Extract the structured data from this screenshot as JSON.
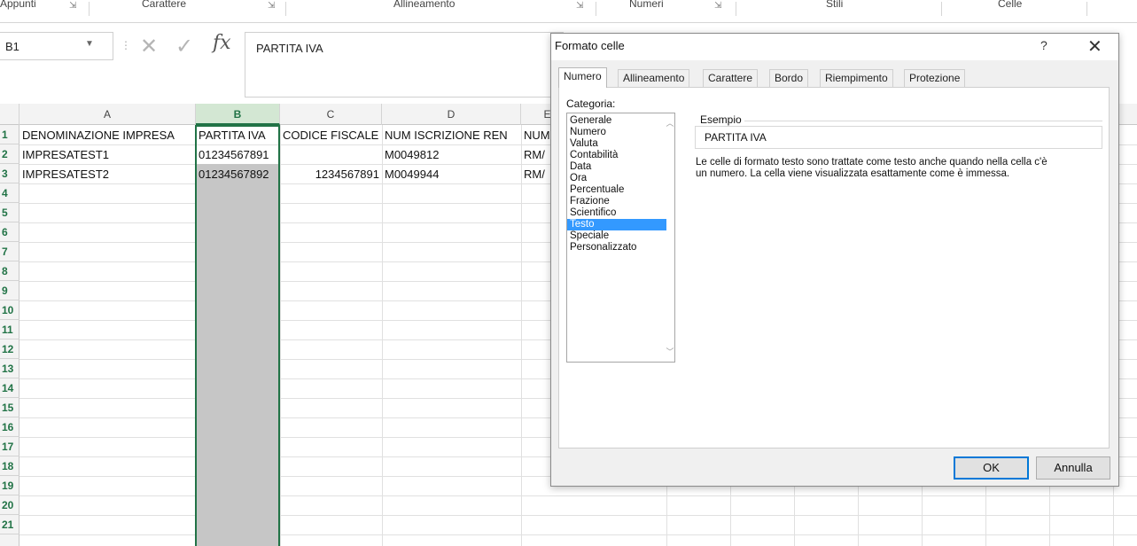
{
  "ribbon": {
    "groups": [
      {
        "label": "Appunti"
      },
      {
        "label": "Carattere"
      },
      {
        "label": "Allineamento"
      },
      {
        "label": "Numeri"
      },
      {
        "label": "Stili"
      },
      {
        "label": "Celle"
      }
    ]
  },
  "formula_bar": {
    "name_box": "B1",
    "fx": "fx",
    "value": "PARTITA IVA"
  },
  "sheet": {
    "columns": [
      "A",
      "B",
      "C",
      "D",
      "E"
    ],
    "selected_column": "B",
    "row_numbers": [
      "1",
      "2",
      "3",
      "4",
      "5",
      "6",
      "7",
      "8",
      "9",
      "10",
      "11",
      "12",
      "13",
      "14",
      "15",
      "16",
      "17",
      "18",
      "19",
      "20",
      "21"
    ],
    "rows": [
      [
        "DENOMINAZIONE IMPRESA",
        "PARTITA IVA",
        "CODICE FISCALE",
        "NUM ISCRIZIONE REN",
        "NUM"
      ],
      [
        "IMPRESATEST1",
        "01234567891",
        "",
        "M0049812",
        "RM/"
      ],
      [
        "IMPRESATEST2",
        "01234567892",
        "1234567891",
        "M0049944",
        "RM/"
      ]
    ]
  },
  "dialog": {
    "title": "Formato celle",
    "help": "?",
    "close": "✕",
    "tabs": [
      "Numero",
      "Allineamento",
      "Carattere",
      "Bordo",
      "Riempimento",
      "Protezione"
    ],
    "active_tab": "Numero",
    "category_label": "Categoria:",
    "categories": [
      "Generale",
      "Numero",
      "Valuta",
      "Contabilità",
      "Data",
      "Ora",
      "Percentuale",
      "Frazione",
      "Scientifico",
      "Testo",
      "Speciale",
      "Personalizzato"
    ],
    "selected_category": "Testo",
    "example_label": "Esempio",
    "example_value": "PARTITA IVA",
    "description_line1": "Le celle di formato testo sono trattate come testo anche quando nella cella c'è",
    "description_line2": "un numero. La cella viene visualizzata esattamente come è immessa.",
    "ok_label": "OK",
    "cancel_label": "Annulla"
  },
  "colors": {
    "accent": "#217346",
    "selection": "#3399ff",
    "column_fill": "#c6c6c6"
  }
}
